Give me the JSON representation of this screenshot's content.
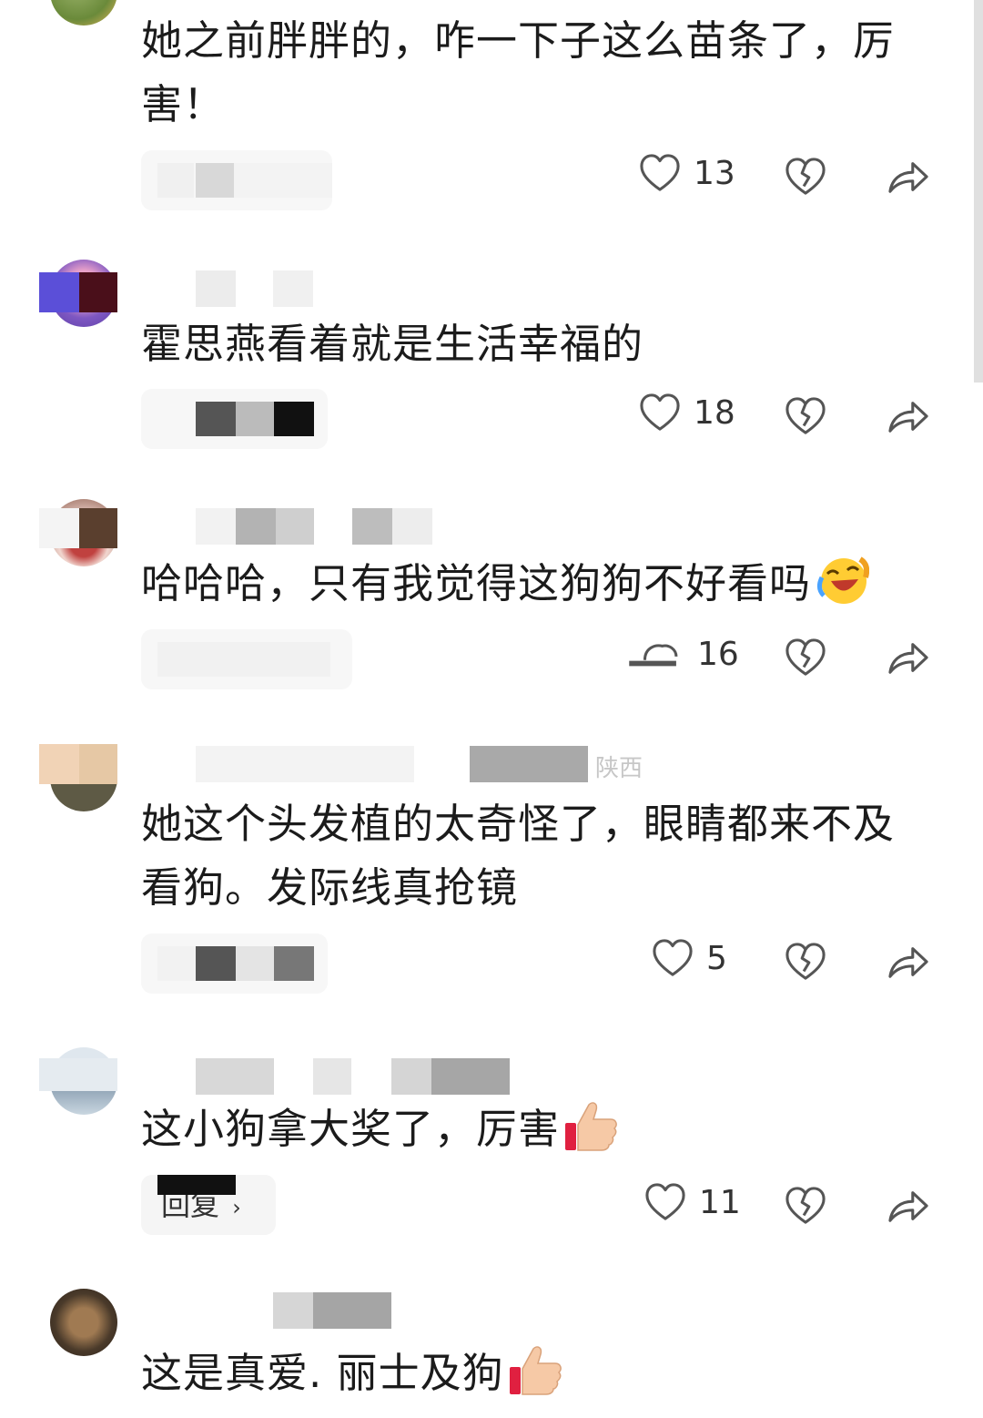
{
  "comments": [
    {
      "text": "她之前胖胖的，咋一下子这么苗条了，厉害！",
      "likes": "13",
      "reply_label": "",
      "emoji": ""
    },
    {
      "text": "霍思燕看着就是生活幸福的",
      "likes": "18",
      "reply_label": "",
      "emoji": ""
    },
    {
      "text": "哈哈哈，只有我觉得这狗狗不好看吗",
      "likes": "16",
      "reply_label": "",
      "emoji": "laughing-tears-emoji"
    },
    {
      "text": "她这个头发植的太奇怪了，眼睛都来不及看狗。发际线真抢镜",
      "likes": "5",
      "reply_label": "",
      "emoji": "",
      "meta_location": "陕西"
    },
    {
      "text": "这小狗拿大奖了，厉害",
      "likes": "11",
      "reply_label": "回复",
      "emoji": "thumbs-up-emoji"
    },
    {
      "text": "这是真爱.       丽士及狗",
      "likes": "",
      "reply_label": "",
      "emoji": "thumbs-up-emoji"
    }
  ],
  "icons": {
    "like": "heart-outline-icon",
    "dislike": "broken-heart-icon",
    "share": "share-arrow-icon",
    "reply_chevron": "chevron-right-icon"
  },
  "colors": {
    "icon": "#555555",
    "reply_bg": "#f5f5f5"
  }
}
